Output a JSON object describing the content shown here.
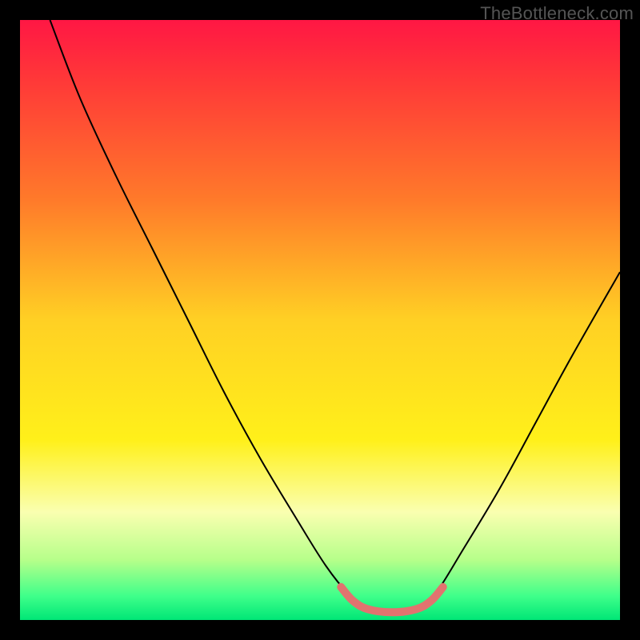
{
  "watermark": "TheBottleneck.com",
  "chart_data": {
    "type": "line",
    "title": "",
    "xlabel": "",
    "ylabel": "",
    "xlim": [
      0,
      100
    ],
    "ylim": [
      0,
      100
    ],
    "grid": false,
    "legend": false,
    "background_gradient": {
      "stops": [
        {
          "offset": 0.0,
          "color": "#ff1744"
        },
        {
          "offset": 0.1,
          "color": "#ff3838"
        },
        {
          "offset": 0.3,
          "color": "#ff7a2a"
        },
        {
          "offset": 0.5,
          "color": "#ffd024"
        },
        {
          "offset": 0.7,
          "color": "#fff01a"
        },
        {
          "offset": 0.82,
          "color": "#faffb0"
        },
        {
          "offset": 0.9,
          "color": "#b6ff8a"
        },
        {
          "offset": 0.96,
          "color": "#3fff8a"
        },
        {
          "offset": 1.0,
          "color": "#00e676"
        }
      ]
    },
    "series": [
      {
        "name": "bottleneck-curve",
        "stroke": "#000000",
        "stroke_width": 2,
        "points": [
          {
            "x": 5.0,
            "y": 100.0
          },
          {
            "x": 10.0,
            "y": 87.0
          },
          {
            "x": 16.0,
            "y": 74.0
          },
          {
            "x": 22.0,
            "y": 62.0
          },
          {
            "x": 28.0,
            "y": 50.0
          },
          {
            "x": 34.0,
            "y": 38.0
          },
          {
            "x": 40.0,
            "y": 27.0
          },
          {
            "x": 46.0,
            "y": 17.0
          },
          {
            "x": 51.0,
            "y": 9.0
          },
          {
            "x": 55.0,
            "y": 4.0
          },
          {
            "x": 58.0,
            "y": 1.5
          },
          {
            "x": 62.0,
            "y": 1.0
          },
          {
            "x": 66.0,
            "y": 1.5
          },
          {
            "x": 69.0,
            "y": 4.0
          },
          {
            "x": 74.0,
            "y": 12.0
          },
          {
            "x": 80.0,
            "y": 22.0
          },
          {
            "x": 86.0,
            "y": 33.0
          },
          {
            "x": 92.0,
            "y": 44.0
          },
          {
            "x": 100.0,
            "y": 58.0
          }
        ]
      },
      {
        "name": "bottom-highlight",
        "stroke": "#e1736f",
        "stroke_width": 10,
        "linecap": "round",
        "points": [
          {
            "x": 53.5,
            "y": 5.5
          },
          {
            "x": 55.5,
            "y": 3.2
          },
          {
            "x": 58.0,
            "y": 1.8
          },
          {
            "x": 62.0,
            "y": 1.3
          },
          {
            "x": 66.0,
            "y": 1.8
          },
          {
            "x": 68.5,
            "y": 3.2
          },
          {
            "x": 70.5,
            "y": 5.5
          }
        ]
      }
    ]
  }
}
